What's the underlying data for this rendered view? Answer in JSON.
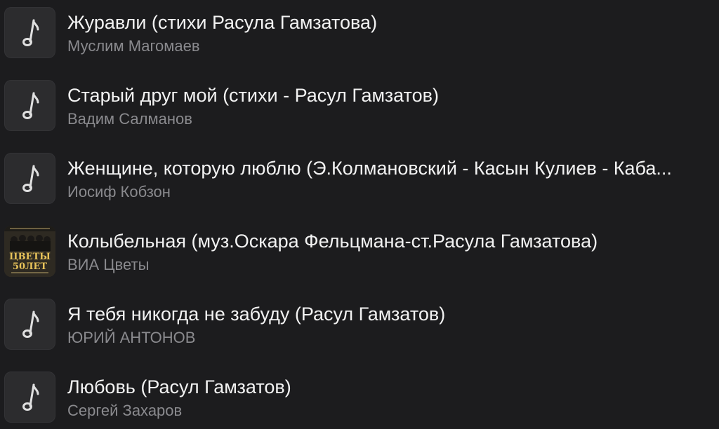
{
  "tracks": [
    {
      "title": "Журавли (стихи Расула Гамзатова)",
      "artist": "Муслим Магомаев",
      "artwork": "music-note-icon"
    },
    {
      "title": "Старый друг мой (стихи - Расул Гамзатов)",
      "artist": "Вадим Салманов",
      "artwork": "music-note-icon"
    },
    {
      "title": "Женщине, которую люблю (Э.Колмановский - Касын Кулиев - Каба...",
      "artist": "Иосиф Кобзон",
      "artwork": "music-note-icon"
    },
    {
      "title": "Колыбельная (муз.Оскара Фельцмана-ст.Расула Гамзатова)",
      "artist": "ВИА Цветы",
      "artwork": "album-cover",
      "cover_text": [
        "ЦВЕТЫ",
        "50ЛЕТ"
      ]
    },
    {
      "title": "Я тебя никогда не забуду (Расул Гамзатов)",
      "artist": "ЮРИЙ АНТОНОВ",
      "artwork": "music-note-icon"
    },
    {
      "title": "Любовь (Расул Гамзатов)",
      "artist": "Сергей Захаров",
      "artwork": "music-note-icon"
    }
  ],
  "colors": {
    "background": "#1c1c1e",
    "title": "#f2f2f2",
    "artist": "#8a8a8e",
    "thumb": "#2c2c2e"
  }
}
